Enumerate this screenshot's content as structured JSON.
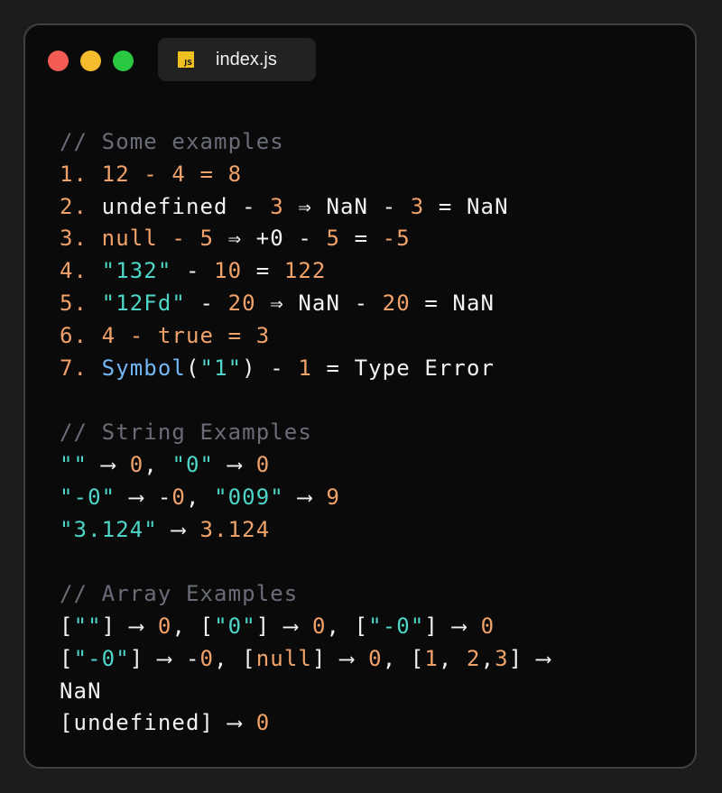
{
  "window": {
    "traffic_lights": [
      {
        "name": "close",
        "color": "#f25c54"
      },
      {
        "name": "minimize",
        "color": "#f5bd2e"
      },
      {
        "name": "maximize",
        "color": "#29c840"
      }
    ],
    "tab": {
      "badge": "JS",
      "filename": "index.js"
    }
  },
  "colors": {
    "comment": "#6a6d78",
    "number": "#f0a26a",
    "string": "#4dd6c8",
    "function": "#72b7f4",
    "text": "#f2f2f2"
  },
  "code_lines": [
    [
      [
        "c",
        "// Some examples"
      ]
    ],
    [
      [
        "o",
        "1. 12 - 4 = 8"
      ]
    ],
    [
      [
        "o",
        "2. "
      ],
      [
        "w",
        "undefined - "
      ],
      [
        "o",
        "3"
      ],
      [
        "w",
        " ⇒ NaN - "
      ],
      [
        "o",
        "3"
      ],
      [
        "w",
        " = NaN"
      ]
    ],
    [
      [
        "o",
        "3. null - 5"
      ],
      [
        "w",
        " ⇒ +0 - "
      ],
      [
        "o",
        "5"
      ],
      [
        "w",
        " = "
      ],
      [
        "o",
        "-5"
      ]
    ],
    [
      [
        "o",
        "4. "
      ],
      [
        "s",
        "\"132\""
      ],
      [
        "w",
        " - "
      ],
      [
        "o",
        "10"
      ],
      [
        "w",
        " = "
      ],
      [
        "o",
        "122"
      ]
    ],
    [
      [
        "o",
        "5. "
      ],
      [
        "s",
        "\"12Fd\""
      ],
      [
        "w",
        " - "
      ],
      [
        "o",
        "20"
      ],
      [
        "w",
        " ⇒ NaN - "
      ],
      [
        "o",
        "20"
      ],
      [
        "w",
        " = NaN"
      ]
    ],
    [
      [
        "o",
        "6. 4 - true = 3"
      ]
    ],
    [
      [
        "o",
        "7. "
      ],
      [
        "f",
        "Symbol"
      ],
      [
        "w",
        "("
      ],
      [
        "s",
        "\"1\""
      ],
      [
        "w",
        ") - "
      ],
      [
        "o",
        "1"
      ],
      [
        "w",
        " = Type Error"
      ]
    ],
    [],
    [
      [
        "c",
        "// String Examples"
      ]
    ],
    [
      [
        "s",
        "\"\""
      ],
      [
        "w",
        " ⟶ "
      ],
      [
        "o",
        "0"
      ],
      [
        "w",
        ", "
      ],
      [
        "s",
        "\"0\""
      ],
      [
        "w",
        " ⟶ "
      ],
      [
        "o",
        "0"
      ]
    ],
    [
      [
        "s",
        "\"-0\""
      ],
      [
        "w",
        " ⟶ -"
      ],
      [
        "o",
        "0"
      ],
      [
        "w",
        ", "
      ],
      [
        "s",
        "\"009\""
      ],
      [
        "w",
        " ⟶ "
      ],
      [
        "o",
        "9"
      ]
    ],
    [
      [
        "s",
        "\"3.124\""
      ],
      [
        "w",
        " ⟶ "
      ],
      [
        "o",
        "3.124"
      ]
    ],
    [],
    [
      [
        "c",
        "// Array Examples"
      ]
    ],
    [
      [
        "w",
        "["
      ],
      [
        "s",
        "\"\""
      ],
      [
        "w",
        "] ⟶ "
      ],
      [
        "o",
        "0"
      ],
      [
        "w",
        ", ["
      ],
      [
        "s",
        "\"0\""
      ],
      [
        "w",
        "] ⟶ "
      ],
      [
        "o",
        "0"
      ],
      [
        "w",
        ", ["
      ],
      [
        "s",
        "\"-0\""
      ],
      [
        "w",
        "] ⟶ "
      ],
      [
        "o",
        "0"
      ]
    ],
    [
      [
        "w",
        "["
      ],
      [
        "s",
        "\"-0\""
      ],
      [
        "w",
        "] ⟶ -"
      ],
      [
        "o",
        "0"
      ],
      [
        "w",
        ", ["
      ],
      [
        "o",
        "null"
      ],
      [
        "w",
        "] ⟶ "
      ],
      [
        "o",
        "0"
      ],
      [
        "w",
        ", ["
      ],
      [
        "o",
        "1"
      ],
      [
        "w",
        ", "
      ],
      [
        "o",
        "2"
      ],
      [
        "w",
        ","
      ],
      [
        "o",
        "3"
      ],
      [
        "w",
        "] ⟶"
      ]
    ],
    [
      [
        "w",
        "NaN"
      ]
    ],
    [
      [
        "w",
        "[undefined] ⟶ "
      ],
      [
        "o",
        "0"
      ]
    ]
  ]
}
